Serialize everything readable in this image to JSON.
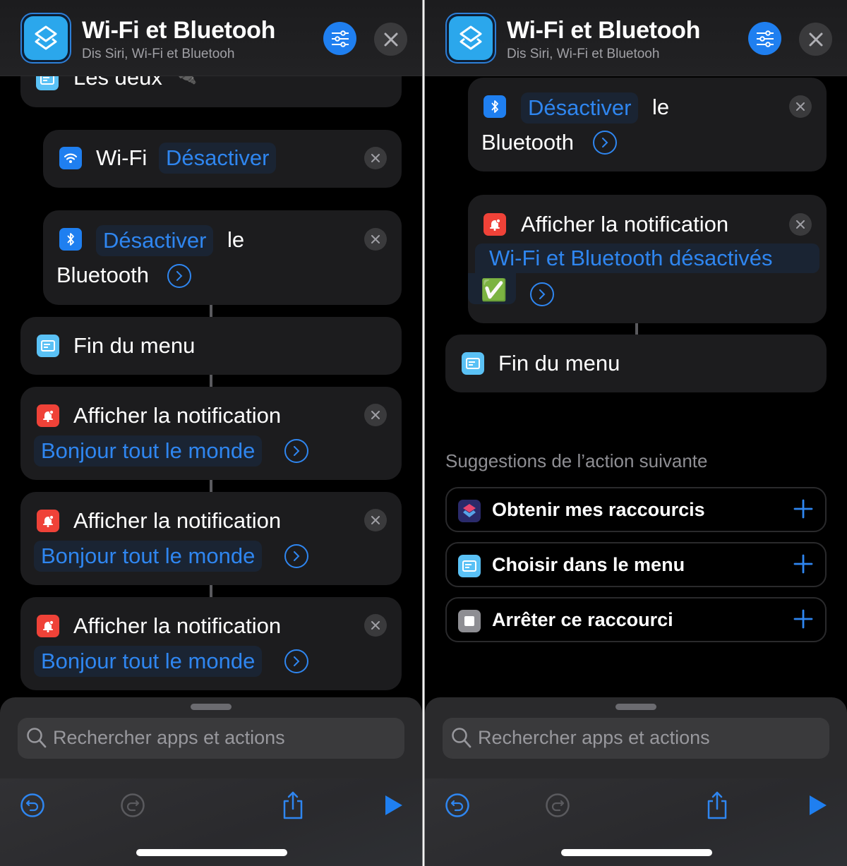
{
  "header": {
    "title": "Wi-Fi et Bluetooh",
    "subtitle": "Dis Siri, Wi-Fi et Bluetooh"
  },
  "left": {
    "truncated_item": {
      "label": "Les deux",
      "emoji": "🔌"
    },
    "wifi_action": {
      "label": "Wi-Fi",
      "param": "Désactiver"
    },
    "bt_action": {
      "param": "Désactiver",
      "word": "le",
      "label": "Bluetooth"
    },
    "end_menu": {
      "label": "Fin du menu"
    },
    "notifications": [
      {
        "label": "Afficher la notification",
        "param": "Bonjour tout le monde"
      },
      {
        "label": "Afficher la notification",
        "param": "Bonjour tout le monde"
      },
      {
        "label": "Afficher la notification",
        "param": "Bonjour tout le monde"
      }
    ]
  },
  "right": {
    "bt_action": {
      "param": "Désactiver",
      "word": "le",
      "label": "Bluetooth"
    },
    "notification": {
      "label": "Afficher la notification",
      "param": "Wi-Fi et Bluetooth désactivés",
      "param_emoji": "✅"
    },
    "end_menu": {
      "label": "Fin du menu"
    },
    "suggestions": {
      "title": "Suggestions de l’action suivante",
      "items": [
        {
          "label": "Obtenir mes raccourcis",
          "icon": "shortcuts-icon"
        },
        {
          "label": "Choisir dans le menu",
          "icon": "menu-icon"
        },
        {
          "label": "Arrêter ce raccourci",
          "icon": "stop-icon"
        }
      ]
    }
  },
  "search": {
    "placeholder": "Rechercher apps et actions"
  },
  "toolbar": {
    "undo": "undo",
    "redo": "redo",
    "share": "share",
    "run": "run"
  },
  "colors": {
    "accent": "#1f7ff0",
    "notification_red": "#ef4238",
    "menu_blue": "#5ac1f5",
    "card_bg": "#1c1c1e"
  }
}
